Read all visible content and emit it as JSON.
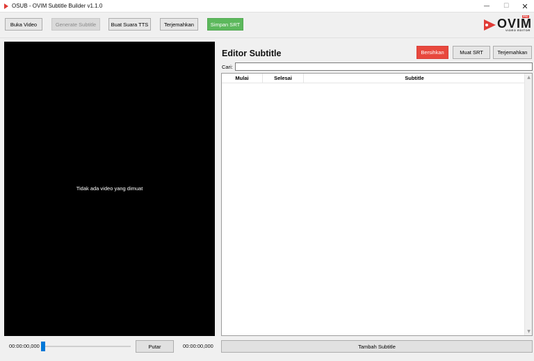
{
  "window": {
    "title": "OSUB - OVIM Subtitle Builder v1.1.0",
    "minimize_glyph": "—",
    "maximize_glyph": "☐",
    "close_glyph": "✕"
  },
  "toolbar": {
    "open_video": "Buka Video",
    "generate_subtitle": "Generate Subtitle",
    "make_tts": "Buat Suara TTS",
    "translate": "Terjemahkan",
    "save_srt": "Simpan SRT"
  },
  "logo": {
    "word": "OVIM",
    "tagline": "VIDEO EDITOR",
    "badge": "PRO"
  },
  "video": {
    "empty_message": "Tidak ada video yang dimuat"
  },
  "playback": {
    "current_time": "00:00:00,000",
    "total_time": "00:00:00,000",
    "play_label": "Putar",
    "progress": 0
  },
  "editor": {
    "title": "Editor Subtitle",
    "clear_label": "Bersihkan",
    "load_srt_label": "Muat SRT",
    "translate_label": "Terjemahkan",
    "search_label": "Cari:",
    "search_value": "",
    "columns": [
      "Mulai",
      "Selesai",
      "Subtitle"
    ],
    "rows": [],
    "add_label": "Tambah Subtitle"
  },
  "colors": {
    "danger": "#e8483d",
    "success": "#5cb85c",
    "accent": "#0078d7",
    "logo_red": "#e03b36"
  }
}
